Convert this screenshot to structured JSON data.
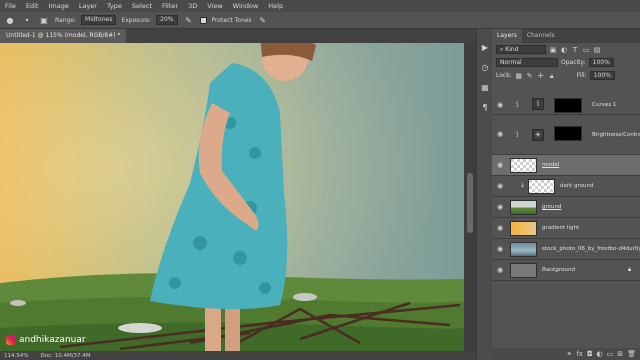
{
  "menu": [
    "File",
    "Edit",
    "Image",
    "Layer",
    "Type",
    "Select",
    "Filter",
    "3D",
    "View",
    "Window",
    "Help"
  ],
  "options": {
    "range_label": "Range:",
    "range_value": "Midtones",
    "exposure_label": "Exposure:",
    "exposure_value": "20%",
    "protect_tones_label": "Protect Tones"
  },
  "document": {
    "tab_title": "Untitled-1 @ 115% (model, RGB/8#) *"
  },
  "status": {
    "zoom": "114.54%",
    "doc": "Doc: 10.4M/37.4M"
  },
  "watermark": {
    "handle": "andhikazanuar"
  },
  "panel": {
    "tabs": [
      "Layers",
      "Channels"
    ],
    "filter_kind": "Kind",
    "blend_mode": "Normal",
    "opacity_label": "Opacity:",
    "opacity_value": "100%",
    "lock_label": "Lock:",
    "fill_label": "Fill:",
    "fill_value": "100%"
  },
  "layers": [
    {
      "name": "Curves 1",
      "type": "adjustment"
    },
    {
      "name": "Brightness/Contrast 1",
      "type": "adjustment"
    },
    {
      "name": "model",
      "type": "layer",
      "selected": true
    },
    {
      "name": "dark ground",
      "type": "clipped"
    },
    {
      "name": "ground",
      "type": "layer"
    },
    {
      "name": "gradient light",
      "type": "layer"
    },
    {
      "name": "stock_photo_06_by_frostbo-d4dur0y",
      "type": "layer"
    },
    {
      "name": "Background",
      "type": "layer"
    }
  ],
  "colors": {
    "accent": "#e6b656",
    "selected_layer": "#6d6d6d"
  }
}
